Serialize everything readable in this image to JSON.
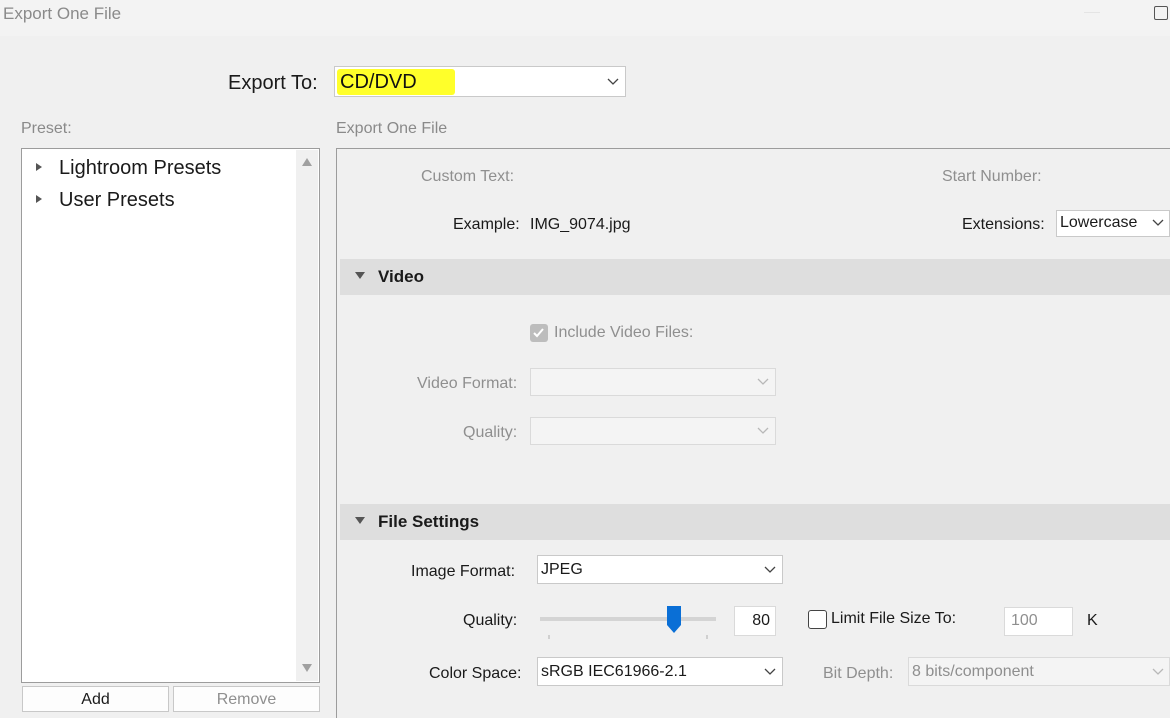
{
  "window": {
    "title": "Export One File"
  },
  "export_to": {
    "label": "Export To:",
    "value": "CD/DVD"
  },
  "preset": {
    "label": "Preset:",
    "items": [
      {
        "label": "Lightroom Presets"
      },
      {
        "label": "User Presets"
      }
    ],
    "add_label": "Add",
    "remove_label": "Remove"
  },
  "section_title": "Export One File",
  "naming": {
    "custom_text_label": "Custom Text:",
    "start_number_label": "Start Number:",
    "example_label": "Example:",
    "example_value": "IMG_9074.jpg",
    "extensions_label": "Extensions:",
    "extensions_value": "Lowercase"
  },
  "video": {
    "header": "Video",
    "include_label": "Include Video Files:",
    "include_checked": true,
    "format_label": "Video Format:",
    "quality_label": "Quality:"
  },
  "file_settings": {
    "header": "File Settings",
    "image_format_label": "Image Format:",
    "image_format_value": "JPEG",
    "quality_label": "Quality:",
    "quality_value": "80",
    "limit_label": "Limit File Size To:",
    "limit_checked": false,
    "limit_value": "100",
    "limit_unit": "K",
    "color_space_label": "Color Space:",
    "color_space_value": "sRGB IEC61966-2.1",
    "bit_depth_label": "Bit Depth:",
    "bit_depth_value": "8 bits/component"
  },
  "colors": {
    "highlight": "#ffff2a",
    "slider_thumb": "#0a6fd6"
  },
  "icons": [
    "expand-triangle-icon",
    "collapse-triangle-icon",
    "chevron-down-icon",
    "checkbox-icon",
    "scroll-up-icon",
    "scroll-down-icon",
    "maximize-icon",
    "minimize-icon"
  ]
}
